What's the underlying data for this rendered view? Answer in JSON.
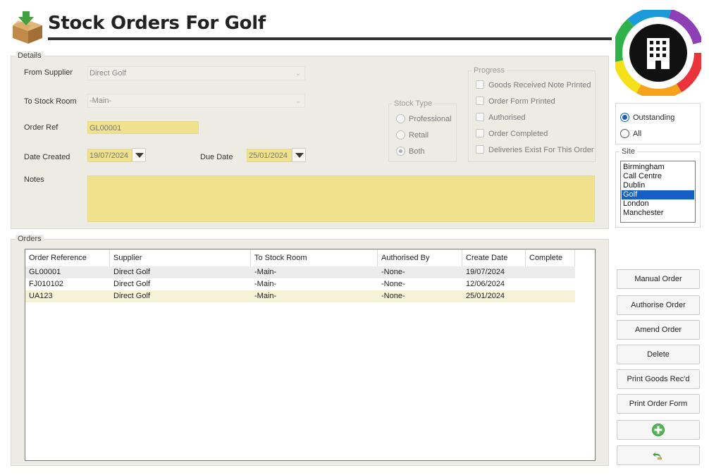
{
  "header": {
    "title": "Stock Orders For Golf"
  },
  "details": {
    "group_label": "Details",
    "from_supplier_label": "From Supplier",
    "from_supplier_value": "Direct Golf",
    "to_stock_room_label": "To Stock Room",
    "to_stock_room_value": "-Main-",
    "order_ref_label": "Order Ref",
    "order_ref_value": "GL00001",
    "date_created_label": "Date Created",
    "date_created_value": "19/07/2024",
    "due_date_label": "Due Date",
    "due_date_value": "25/01/2024",
    "notes_label": "Notes",
    "notes_value": ""
  },
  "stock_type": {
    "label": "Stock Type",
    "options": [
      "Professional",
      "Retail",
      "Both"
    ],
    "selected": "Both"
  },
  "progress": {
    "label": "Progress",
    "items": [
      "Goods Received Note Printed",
      "Order Form Printed",
      "Authorised",
      "Order Completed",
      "Deliveries Exist For This Order"
    ]
  },
  "orders": {
    "group_label": "Orders",
    "columns": [
      "Order Reference",
      "Supplier",
      "To Stock Room",
      "Authorised By",
      "Create Date",
      "Complete"
    ],
    "rows": [
      [
        "GL00001",
        "Direct Golf",
        "-Main-",
        "-None-",
        "19/07/2024",
        ""
      ],
      [
        "FJ010102",
        "Direct Golf",
        "-Main-",
        "-None-",
        "12/06/2024",
        ""
      ],
      [
        "UA123",
        "Direct Golf",
        "-Main-",
        "-None-",
        "25/01/2024",
        ""
      ]
    ]
  },
  "filter": {
    "outstanding_label": "Outstanding",
    "all_label": "All",
    "selected": "Outstanding"
  },
  "site": {
    "label": "Site",
    "items": [
      "Birmingham",
      "Call Centre",
      "Dublin",
      "Golf",
      "London",
      "Manchester"
    ],
    "selected": "Golf"
  },
  "buttons": {
    "manual_order": "Manual Order",
    "authorise_order": "Authorise Order",
    "amend_order": "Amend Order",
    "delete": "Delete",
    "print_goods": "Print Goods Rec'd",
    "print_order_form": "Print Order Form",
    "add_icon": "add-circle-icon",
    "undo_icon": "undo-arrow-icon"
  },
  "colors": {
    "accent": "#1560c2",
    "field_yellow": "#f0e28c",
    "panel": "#ecebe4"
  }
}
